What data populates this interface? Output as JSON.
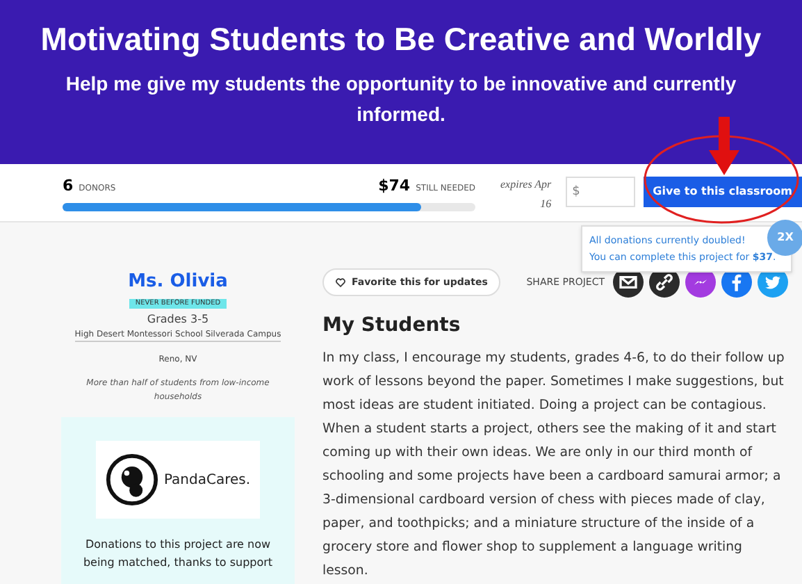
{
  "header": {
    "title": "Motivating Students to Be Creative and Worldly",
    "subtitle": "Help me give my students the opportunity to be innovative and currently informed."
  },
  "funding": {
    "donors_count": "6",
    "donors_label": "DONORS",
    "amount": "$74",
    "amount_label": "STILL NEEDED",
    "level": 0.87,
    "expires": "expires Apr 16",
    "amount_placeholder": "$",
    "give_button": "Give to this classroom"
  },
  "match_tooltip": {
    "line1": "All donations currently doubled!",
    "line2": "You can complete this project for **$37**.",
    "badge": "2X"
  },
  "teacher": {
    "name": "Ms. Olivia",
    "badge": "NEVER BEFORE FUNDED",
    "grades": "Grades 3-5",
    "school": "High Desert Montessori School Silverada Campus",
    "location": "Reno, NV",
    "income_note": "More than half of students from low-income households"
  },
  "sponsor": {
    "name": "PandaCares.",
    "text": "Donations to this project are now being matched, thanks to support"
  },
  "favorite_button": "Favorite this for updates",
  "share": {
    "label": "SHARE PROJECT",
    "icons": [
      {
        "kind": "email",
        "color": "#2b2b2b"
      },
      {
        "kind": "link",
        "color": "#2b2b2b"
      },
      {
        "kind": "messenger",
        "color": "#a33be0"
      },
      {
        "kind": "facebook",
        "color": "#1877f2"
      },
      {
        "kind": "twitter",
        "color": "#1da1f2"
      }
    ]
  },
  "section": {
    "heading": "My Students",
    "body": "In my class, I encourage my students, grades 4-6, to do their follow up work of lessons beyond the paper. Sometimes I make suggestions, but most ideas are student initiated. Doing a project can be contagious. When a student starts a project, others see the making of it and start coming up with their own ideas. We are only in our third month of schooling and some projects have been a cardboard samurai armor; a 3-dimensional cardboard version of chess with pieces made of clay, paper, and toothpicks; and a miniature structure of the inside of a grocery store and flower shop to supplement a language writing lesson."
  }
}
